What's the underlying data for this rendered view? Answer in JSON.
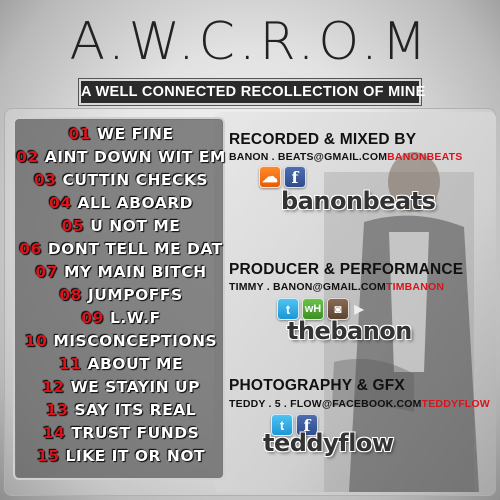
{
  "title": "A.W.C.R.O.M",
  "subtitle": "A WELL CONNECTED RECOLLECTION OF MINE",
  "tracks": [
    {
      "num": "01",
      "name": "WE FINE"
    },
    {
      "num": "02",
      "name": "AINT DOWN WIT EM"
    },
    {
      "num": "03",
      "name": "CUTTIN CHECKS"
    },
    {
      "num": "04",
      "name": "ALL ABOARD"
    },
    {
      "num": "05",
      "name": "U NOT ME"
    },
    {
      "num": "06",
      "name": "DONT TELL ME DAT"
    },
    {
      "num": "07",
      "name": "MY MAIN BITCH"
    },
    {
      "num": "08",
      "name": "JUMPOFFS"
    },
    {
      "num": "09",
      "name": "L.W.F"
    },
    {
      "num": "10",
      "name": "MISCONCEPTIONS"
    },
    {
      "num": "11",
      "name": "ABOUT ME"
    },
    {
      "num": "12",
      "name": "WE STAYIN UP"
    },
    {
      "num": "13",
      "name": "SAY ITS REAL"
    },
    {
      "num": "14",
      "name": "TRUST FUNDS"
    },
    {
      "num": "15",
      "name": "LIKE IT OR NOT"
    }
  ],
  "credits": [
    {
      "title": "RECORDED & MIXED BY",
      "email": "BANON . BEATS@GMAIL.COM",
      "handle": "BANONBEATS",
      "icons": [
        "soundcloud-icon",
        "facebook-icon"
      ],
      "handle_big": "banonbeats"
    },
    {
      "title": "PRODUCER & PERFORMANCE",
      "email": "TIMMY . BANON@GMAIL.COM",
      "handle": "TIMBANON",
      "icons": [
        "twitter-icon",
        "wordhouse-icon",
        "instagram-icon",
        "youtube-icon"
      ],
      "handle_big": "thebanon"
    },
    {
      "title": "PHOTOGRAPHY & GFX",
      "email": "TEDDY . 5 . FLOW@FACEBOOK.COM",
      "handle": "TEDDYFLOW",
      "icons": [
        "twitter-icon",
        "facebook-icon"
      ],
      "handle_big": "teddyflow"
    }
  ],
  "icon_glyphs": {
    "soundcloud": "☁",
    "facebook": "f",
    "twitter": "t",
    "wordhouse": "wH",
    "instagram": "◙",
    "youtube": "▶"
  },
  "colors": {
    "accent_red": "#d9141c",
    "panel_dark": "#2b2b2b"
  }
}
